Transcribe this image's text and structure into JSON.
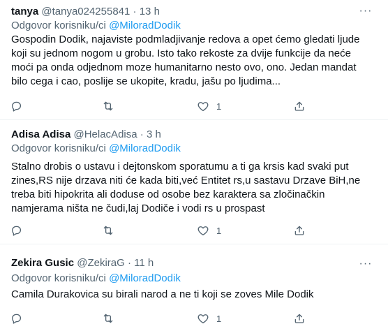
{
  "tweets": [
    {
      "name": "tanya",
      "handle": "@tanya024255841",
      "separator": "·",
      "time": "13 h",
      "replying_prefix": "Odgovor korisniku/ci ",
      "replying_to": "@MiloradDodik",
      "text": "Gospodin Dodik, najaviste podmladjivanje redova a opet ćemo gledati ljude koji su jednom nogom u grobu. Isto tako rekoste za dvije funkcije da neće moći pa onda odjednom moze humanitarno nesto ovo, ono. Jedan mandat bilo cega i cao, poslije se ukopite, kradu, jašu po ljudima...",
      "like_count": "1"
    },
    {
      "name": "Adisa Adisa",
      "handle": "@HelacAdisa",
      "separator": "·",
      "time": "3 h",
      "replying_prefix": "Odgovor korisniku/ci ",
      "replying_to": "@MiloradDodik",
      "text": "Stalno drobis o ustavu i dejtonskom sporatumu a ti ga krsis kad svaki put zines,RS nije drzava niti će kada biti,već Entitet rs,u sastavu Drzave BiH,ne treba biti hipokrita ali doduse od osobe bez karaktera sa zločinačkin namjerama ništa ne čudi,laj Dodiče i vodi rs u prospast",
      "like_count": "1"
    },
    {
      "name": "Zekira Gusic",
      "handle": "@ZekiraG",
      "separator": "·",
      "time": "11 h",
      "replying_prefix": "Odgovor korisniku/ci ",
      "replying_to": "@MiloradDodik",
      "text": "Camila Durakovica su birali narod a ne ti koji se zoves Mile Dodik",
      "like_count": "1"
    }
  ],
  "icons": {
    "reply": "reply-icon",
    "retweet": "retweet-icon",
    "like": "heart-icon",
    "share": "share-icon",
    "more": "more-icon"
  },
  "colors": {
    "text": "#0f1419",
    "secondary": "#536471",
    "link": "#1d9bf0",
    "divider": "#eff3f4"
  }
}
